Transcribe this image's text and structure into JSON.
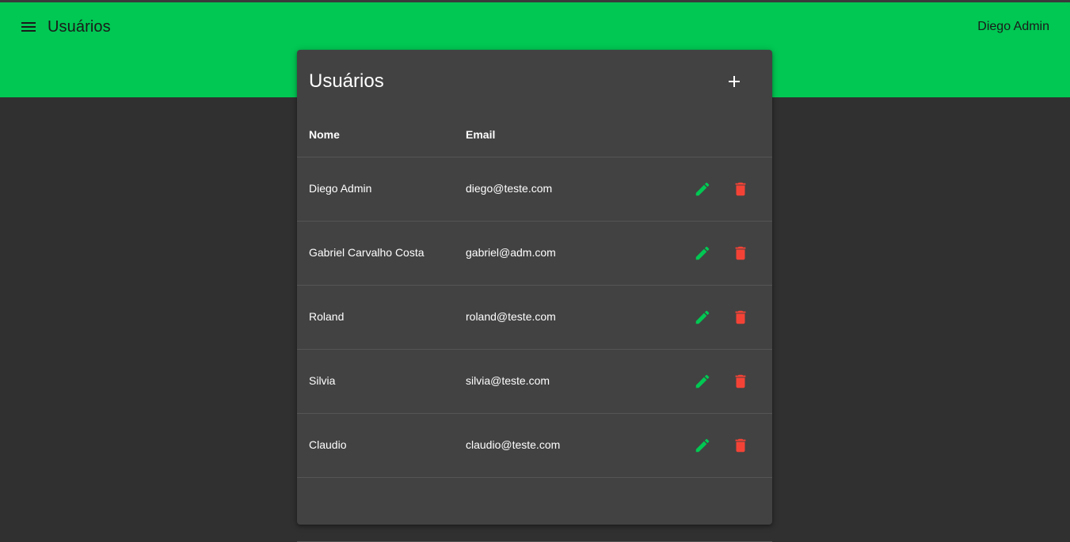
{
  "header": {
    "title": "Usuários",
    "user_name": "Diego Admin",
    "menu_icon": "menu-icon"
  },
  "card": {
    "title": "Usuários",
    "add_icon": "plus-icon",
    "columns": {
      "name": "Nome",
      "email": "Email"
    },
    "rows": [
      {
        "name": "Diego Admin",
        "email": "diego@teste.com"
      },
      {
        "name": "Gabriel Carvalho Costa",
        "email": "gabriel@adm.com"
      },
      {
        "name": "Roland",
        "email": "roland@teste.com"
      },
      {
        "name": "Silvia",
        "email": "silvia@teste.com"
      },
      {
        "name": "Claudio",
        "email": "claudio@teste.com"
      },
      {
        "name": "",
        "email": ""
      }
    ],
    "edit_icon": "pencil-icon",
    "delete_icon": "trash-icon"
  },
  "colors": {
    "appbar": "#00c853",
    "background": "#303030",
    "card": "#424242",
    "edit": "#00c853",
    "delete": "#f44336"
  }
}
